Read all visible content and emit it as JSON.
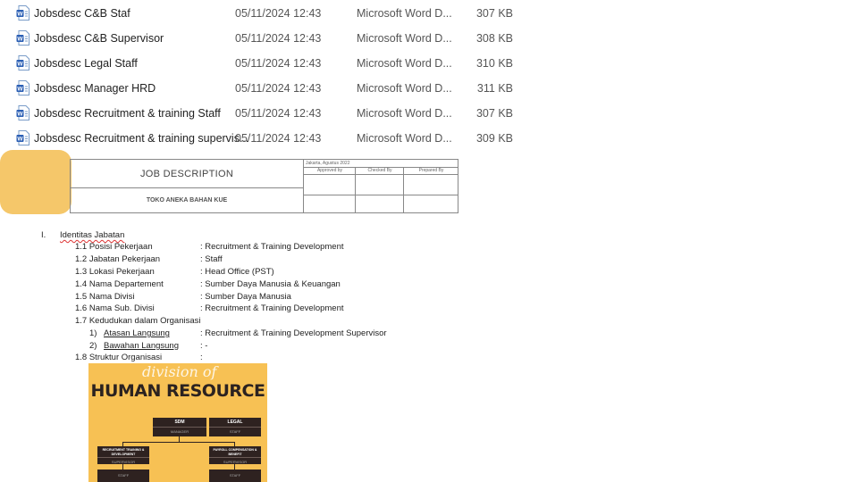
{
  "files": [
    {
      "name": "Jobsdesc C&B Staf",
      "date": "05/11/2024 12:43",
      "type": "Microsoft Word D...",
      "size": "307 KB"
    },
    {
      "name": "Jobsdesc C&B Supervisor",
      "date": "05/11/2024 12:43",
      "type": "Microsoft Word D...",
      "size": "308 KB"
    },
    {
      "name": "Jobsdesc Legal Staff",
      "date": "05/11/2024 12:43",
      "type": "Microsoft Word D...",
      "size": "310 KB"
    },
    {
      "name": "Jobsdesc Manager HRD",
      "date": "05/11/2024 12:43",
      "type": "Microsoft Word D...",
      "size": "311 KB"
    },
    {
      "name": "Jobsdesc Recruitment & training Staff",
      "date": "05/11/2024 12:43",
      "type": "Microsoft Word D...",
      "size": "307 KB"
    },
    {
      "name": "Jobsdesc Recruitment & training supervis...",
      "date": "05/11/2024 12:43",
      "type": "Microsoft Word D...",
      "size": "309 KB"
    }
  ],
  "doc_header": {
    "title": "JOB DESCRIPTION",
    "subtitle": "TOKO ANEKA BAHAN KUE",
    "place_date": "Jakarta,      Agustus 2022",
    "approved": "Approved by",
    "checked": "Checked By",
    "prepared": "Prepared By"
  },
  "section": {
    "numeral": "I.",
    "heading": "Identitas Jabatan",
    "items": [
      {
        "label": "1.1 Posisi Pekerjaan",
        "value": ": Recruitment & Training Development"
      },
      {
        "label": "1.2 Jabatan Pekerjaan",
        "value": ": Staff"
      },
      {
        "label": "1.3 Lokasi Pekerjaan",
        "value": ": Head Office (PST)"
      },
      {
        "label": "1.4 Nama Departement",
        "value": ": Sumber Daya Manusia & Keuangan"
      },
      {
        "label": "1.5 Nama Divisi",
        "value": ": Sumber Daya Manusia"
      },
      {
        "label": "1.6 Nama Sub. Divisi",
        "value": ": Recruitment & Training Development"
      },
      {
        "label": "1.7 Kedudukan dalam Organisasi",
        "value": ""
      }
    ],
    "subitems": [
      {
        "num": "1)",
        "label": "Atasan Langsung",
        "value": ": Recruitment & Training Development Supervisor"
      },
      {
        "num": "2)",
        "label": "Bawahan Langsung",
        "value": ": -"
      }
    ],
    "struktur_label": "1.8 Struktur Organisasi",
    "struktur_value": ":"
  },
  "org_chart": {
    "script": "division of",
    "title": "HUMAN RESOURCE",
    "sdm": "SDM",
    "sdm_sub": "MANAGER",
    "legal": "LEGAL",
    "legal_sub": "STAFF",
    "recruit": "RECRUITMENT TRAINING & DEVELOPMENT",
    "recruit_sub": "SUPERVISOR",
    "payroll": "PAYROLL COMPENSATION & BENEFIT",
    "payroll_sub": "SUPERVISOR",
    "staff1": "STAFF",
    "staff2": "STAFF",
    "bg_color": "#f7c154",
    "box_color": "#2e2220"
  }
}
